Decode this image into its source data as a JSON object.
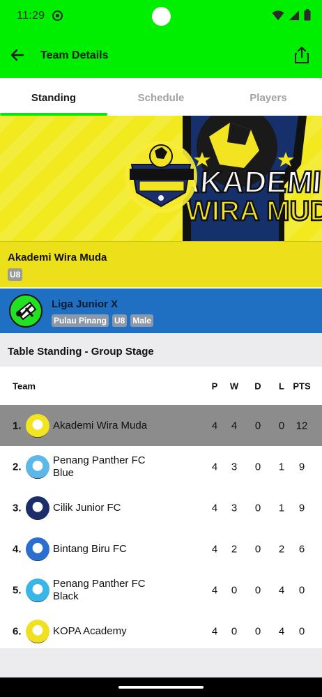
{
  "status": {
    "time": "11:29"
  },
  "app_bar": {
    "title": "Team Details"
  },
  "tabs": [
    {
      "label": "Standing",
      "active": true
    },
    {
      "label": "Schedule",
      "active": false
    },
    {
      "label": "Players",
      "active": false
    }
  ],
  "banner": {
    "logo_text_1": "AKADEMI BOLA SEPAK",
    "logo_text_2": "WIRA MUDA"
  },
  "team": {
    "name": "Akademi Wira Muda",
    "age_group": "U8"
  },
  "league": {
    "name": "Liga Junior X",
    "location": "Pulau Pinang",
    "age_group": "U8",
    "gender": "Male"
  },
  "standing": {
    "section_title": "Table Standing - Group Stage",
    "columns": {
      "team": "Team",
      "p": "P",
      "w": "W",
      "d": "D",
      "l": "L",
      "pts": "PTS"
    },
    "rows": [
      {
        "rank": "1.",
        "team": "Akademi Wira Muda",
        "p": "4",
        "w": "4",
        "d": "0",
        "l": "0",
        "pts": "12",
        "highlight": true,
        "logo_color": "#f2e420"
      },
      {
        "rank": "2.",
        "team": "Penang Panther FC Blue",
        "p": "4",
        "w": "3",
        "d": "0",
        "l": "1",
        "pts": "9",
        "highlight": false,
        "logo_color": "#5bb8e8"
      },
      {
        "rank": "3.",
        "team": "Cilik Junior FC",
        "p": "4",
        "w": "3",
        "d": "0",
        "l": "1",
        "pts": "9",
        "highlight": false,
        "logo_color": "#1b2d6b"
      },
      {
        "rank": "4.",
        "team": "Bintang Biru FC",
        "p": "4",
        "w": "2",
        "d": "0",
        "l": "2",
        "pts": "6",
        "highlight": false,
        "logo_color": "#2a6fd0"
      },
      {
        "rank": "5.",
        "team": "Penang Panther FC Black",
        "p": "4",
        "w": "0",
        "d": "0",
        "l": "4",
        "pts": "0",
        "highlight": false,
        "logo_color": "#38b6e8"
      },
      {
        "rank": "6.",
        "team": "KOPA Academy",
        "p": "4",
        "w": "0",
        "d": "0",
        "l": "4",
        "pts": "0",
        "highlight": false,
        "logo_color": "#f0e020"
      }
    ]
  },
  "colors": {
    "accent": "#00ee00",
    "banner": "#f3e91f",
    "league_bar": "#1f6fc2",
    "highlight_row": "#8c8c8c"
  }
}
